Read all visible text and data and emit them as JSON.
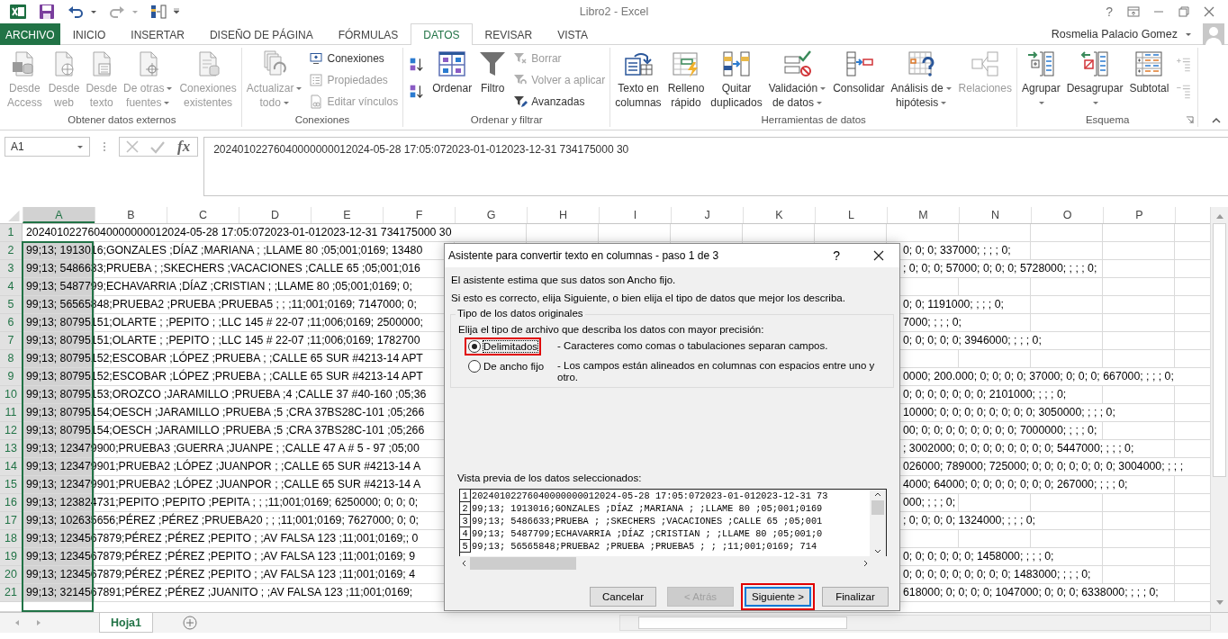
{
  "window": {
    "title": "Libro2 - Excel",
    "help": "?"
  },
  "tabs": [
    {
      "label": "ARCHIVO",
      "kind": "file",
      "selected": false
    },
    {
      "label": "INICIO",
      "kind": "tab",
      "selected": false
    },
    {
      "label": "INSERTAR",
      "kind": "tab",
      "selected": false
    },
    {
      "label": "DISEÑO DE PÁGINA",
      "kind": "tab",
      "selected": false
    },
    {
      "label": "FÓRMULAS",
      "kind": "tab",
      "selected": false
    },
    {
      "label": "DATOS",
      "kind": "tab",
      "selected": true
    },
    {
      "label": "REVISAR",
      "kind": "tab",
      "selected": false
    },
    {
      "label": "VISTA",
      "kind": "tab",
      "selected": false
    }
  ],
  "user": {
    "name": "Rosmelia Palacio Gomez"
  },
  "ribbon": {
    "groups": [
      {
        "label": "Obtener datos externos",
        "launcher": false,
        "items": [
          {
            "kind": "large",
            "lines": [
              "Desde",
              "Access"
            ],
            "disabled": true,
            "dropdown": false
          },
          {
            "kind": "large",
            "lines": [
              "Desde",
              "web"
            ],
            "disabled": true,
            "dropdown": false
          },
          {
            "kind": "large",
            "lines": [
              "Desde",
              "texto"
            ],
            "disabled": true,
            "dropdown": false
          },
          {
            "kind": "large",
            "lines": [
              "De otras",
              "fuentes"
            ],
            "disabled": true,
            "dropdown": true
          },
          {
            "kind": "large",
            "lines": [
              "Conexiones",
              "existentes"
            ],
            "disabled": true,
            "dropdown": false
          }
        ]
      },
      {
        "label": "Conexiones",
        "launcher": false,
        "items": [
          {
            "kind": "large",
            "lines": [
              "Actualizar",
              "todo"
            ],
            "disabled": true,
            "dropdown": true
          },
          {
            "kind": "small",
            "lines": [
              "Conexiones"
            ],
            "disabled": false
          },
          {
            "kind": "small",
            "lines": [
              "Propiedades"
            ],
            "disabled": true
          },
          {
            "kind": "small",
            "lines": [
              "Editar vínculos"
            ],
            "disabled": true
          }
        ]
      },
      {
        "label": "Ordenar y filtrar",
        "launcher": false,
        "items": [
          {
            "kind": "icon",
            "disabled": false
          },
          {
            "kind": "icon",
            "disabled": false
          },
          {
            "kind": "large",
            "lines": [
              "Ordenar"
            ],
            "disabled": false,
            "dropdown": false
          },
          {
            "kind": "large",
            "lines": [
              "Filtro"
            ],
            "disabled": false,
            "dropdown": false
          },
          {
            "kind": "small",
            "lines": [
              "Borrar"
            ],
            "disabled": true
          },
          {
            "kind": "small",
            "lines": [
              "Volver a aplicar"
            ],
            "disabled": true
          },
          {
            "kind": "small",
            "lines": [
              "Avanzadas"
            ],
            "disabled": false
          }
        ]
      },
      {
        "label": "Herramientas de datos",
        "launcher": false,
        "items": [
          {
            "kind": "large",
            "lines": [
              "Texto en",
              "columnas"
            ],
            "disabled": false,
            "dropdown": false
          },
          {
            "kind": "large",
            "lines": [
              "Relleno",
              "rápido"
            ],
            "disabled": false,
            "dropdown": false
          },
          {
            "kind": "large",
            "lines": [
              "Quitar",
              "duplicados"
            ],
            "disabled": false,
            "dropdown": false
          },
          {
            "kind": "large",
            "lines": [
              "Validación",
              "de datos"
            ],
            "disabled": false,
            "dropdown": true
          },
          {
            "kind": "large",
            "lines": [
              "Consolidar"
            ],
            "disabled": false,
            "dropdown": false
          },
          {
            "kind": "large",
            "lines": [
              "Análisis de",
              "hipótesis"
            ],
            "disabled": false,
            "dropdown": true
          },
          {
            "kind": "large",
            "lines": [
              "Relaciones"
            ],
            "disabled": true,
            "dropdown": false
          }
        ]
      },
      {
        "label": "Esquema",
        "launcher": true,
        "items": [
          {
            "kind": "large",
            "lines": [
              "Agrupar"
            ],
            "disabled": false,
            "dropdown": true
          },
          {
            "kind": "large",
            "lines": [
              "Desagrupar"
            ],
            "disabled": false,
            "dropdown": true
          },
          {
            "kind": "large",
            "lines": [
              "Subtotal"
            ],
            "disabled": false,
            "dropdown": false
          },
          {
            "kind": "icon",
            "disabled": true
          },
          {
            "kind": "icon",
            "disabled": true
          }
        ]
      }
    ]
  },
  "formula_bar": {
    "name_box": "A1",
    "fx": "fx",
    "value": "20240102276040000000012024-05-28 17:05:072023-01-012023-12-31 734175000 30"
  },
  "sheet": {
    "columns": [
      {
        "label": "A",
        "selected": true
      },
      {
        "label": "B",
        "selected": false
      },
      {
        "label": "C",
        "selected": false
      },
      {
        "label": "D",
        "selected": false
      },
      {
        "label": "E",
        "selected": false
      },
      {
        "label": "F",
        "selected": false
      },
      {
        "label": "G",
        "selected": false
      },
      {
        "label": "H",
        "selected": false
      },
      {
        "label": "I",
        "selected": false
      },
      {
        "label": "J",
        "selected": false
      },
      {
        "label": "K",
        "selected": false
      },
      {
        "label": "L",
        "selected": false
      },
      {
        "label": "M",
        "selected": false
      },
      {
        "label": "N",
        "selected": false
      },
      {
        "label": "O",
        "selected": false
      },
      {
        "label": "P",
        "selected": false
      }
    ],
    "rows": [
      {
        "number": "1",
        "left": "20240102276040000000012024-05-28 17:05:072023-01-012023-12-31 734175000 30"
      },
      {
        "number": "2",
        "left": "99;13; 1913016;GONZALES ;DÍAZ ;MARIANA ; ;LLAME 80 ;05;001;0169; 13480",
        "right": "0; 0; 0; 337000; ; ; ; 0;"
      },
      {
        "number": "3",
        "left": "99;13; 5486633;PRUEBA ; ;SKECHERS ;VACACIONES ;CALLE 65 ;05;001;016",
        "right": "; 0; 0; 0; 57000; 0; 0; 0; 5728000; ; ; ; 0;"
      },
      {
        "number": "4",
        "left": "99;13; 5487799;ECHAVARRIA ;DÍAZ ;CRISTIAN ; ;LLAME 80 ;05;001;0169; 0;"
      },
      {
        "number": "5",
        "left": "99;13; 56565848;PRUEBA2 ;PRUEBA ;PRUEBA5 ; ; ;11;001;0169; 7147000; 0;",
        "right": "0; 0; 1191000; ; ; ; 0;"
      },
      {
        "number": "6",
        "left": "99;13; 80795151;OLARTE ; ;PEPITO ; ;LLC 145 # 22-07 ;11;006;0169; 2500000;",
        "right": "7000; ; ; ; 0;"
      },
      {
        "number": "7",
        "left": "99;13; 80795151;OLARTE ; ;PEPITO ; ;LLC 145 # 22-07 ;11;006;0169; 1782700",
        "right": "0; 0; 0; 0; 0; 3946000; ; ; ; 0;"
      },
      {
        "number": "8",
        "left": "99;13; 80795152;ESCOBAR ;LÓPEZ ;PRUEBA ; ;CALLE 65 SUR #4213-14 APT"
      },
      {
        "number": "9",
        "left": "99;13; 80795152;ESCOBAR ;LÓPEZ ;PRUEBA ; ;CALLE 65 SUR #4213-14 APT",
        "right": "0000; 200.000; 0; 0; 0; 0; 37000; 0; 0; 0; 667000; ; ; ; 0;"
      },
      {
        "number": "10",
        "left": "99;13; 80795153;OROZCO ;JARAMILLO ;PRUEBA ;4 ;CALLE 37 #40-160 ;05;36",
        "right": "0; 0; 0; 0; 0; 0; 0; 2101000; ; ; ; 0;"
      },
      {
        "number": "11",
        "left": "99;13; 80795154;OESCH ;JARAMILLO ;PRUEBA ;5 ;CRA 37BS28C-101 ;05;266",
        "right": "10000; 0; 0; 0; 0; 0; 0; 0; 0; 3050000; ; ; ; 0;"
      },
      {
        "number": "12",
        "left": "99;13; 80795154;OESCH ;JARAMILLO ;PRUEBA ;5 ;CRA 37BS28C-101 ;05;266",
        "right": "00; 0; 0; 0; 0; 0; 0; 0; 0; 7000000; ; ; ; 0;"
      },
      {
        "number": "13",
        "left": "99;13; 123479900;PRUEBA3 ;GUERRA ;JUANPE ; ;CALLE 47 A # 5 - 97 ;05;00",
        "right": "; 3002000; 0; 0; 0; 0; 0; 0; 0; 0; 5447000; ; ; ; 0;"
      },
      {
        "number": "14",
        "left": "99;13; 123479901;PRUEBA2 ;LÓPEZ ;JUANPOR ; ;CALLE 65 SUR #4213-14 A",
        "right": "026000; 789000; 725000; 0; 0; 0; 0; 0; 0; 0; 3004000; ; ; ;"
      },
      {
        "number": "15",
        "left": "99;13; 123479901;PRUEBA2 ;LÓPEZ ;JUANPOR ; ;CALLE 65 SUR #4213-14 A",
        "right": "4000; 64000; 0; 0; 0; 0; 0; 0; 0; 267000; ; ; ; 0;"
      },
      {
        "number": "16",
        "left": "99;13; 123824731;PEPITO ;PEPITO ;PEPITA ; ; ;11;001;0169; 6250000; 0; 0; 0;",
        "right": "000; ; ; ; 0;"
      },
      {
        "number": "17",
        "left": "99;13; 102635656;PÉREZ ;PÉREZ ;PRUEBA20 ; ; ;11;001;0169; 7627000; 0; 0;",
        "right": "; 0; 0; 0; 0; 1324000; ; ; ; 0;"
      },
      {
        "number": "18",
        "left": "99;13; 1234567879;PÉREZ ;PÉREZ ;PEPITO ; ;AV FALSA 123 ;11;001;0169;; 0"
      },
      {
        "number": "19",
        "left": "99;13; 1234567879;PÉREZ ;PÉREZ ;PEPITO ; ;AV FALSA 123 ;11;001;0169; 9",
        "right": "0; 0; 0; 0; 0; 0; 1458000; ; ; ; 0;"
      },
      {
        "number": "20",
        "left": "99;13; 1234567879;PÉREZ ;PÉREZ ;PEPITO ; ;AV FALSA 123 ;11;001;0169; 4",
        "right": "0; 0; 0; 0; 0; 0; 0; 0; 0; 1483000; ; ; ; 0;"
      },
      {
        "number": "21",
        "left": "99;13; 3214567891;PÉREZ ;PÉREZ ;JUANITO ; ;AV FALSA 123 ;11;001;0169;",
        "right": "618000; 0; 0; 0; 0; 1047000; 0; 0; 0; 6338000; ; ; ; 0;"
      }
    ]
  },
  "sheet_tabs": [
    {
      "label": "Hoja1",
      "selected": true
    }
  ],
  "dialog": {
    "title": "Asistente para convertir texto en columnas - paso 1 de 3",
    "help": "?",
    "intro": [
      "El asistente estima que sus datos son Ancho fijo.",
      "Si esto es correcto, elija Siguiente, o bien elija el tipo de datos que mejor los describa."
    ],
    "group_title": "Tipo de los datos originales",
    "prompt": "Elija el tipo de archivo que describa los datos con mayor precisión:",
    "options": [
      {
        "label": "Delimitados",
        "description": "- Caracteres como comas o tabulaciones separan campos.",
        "selected": true,
        "annotated": true
      },
      {
        "label": "De ancho fijo",
        "description": "- Los campos están alineados en columnas con espacios entre uno y otro.",
        "selected": false,
        "annotated": false
      }
    ],
    "preview_label": "Vista previa de los datos seleccionados:",
    "preview": [
      {
        "number": "1",
        "text": "20240102276040000000012024-05-28 17:05:072023-01-012023-12-31 73"
      },
      {
        "number": "2",
        "text": "99;13; 1913016;GONZALES ;DÍAZ ;MARIANA ; ;LLAME 80 ;05;001;0169"
      },
      {
        "number": "3",
        "text": "99;13; 5486633;PRUEBA ; ;SKECHERS ;VACACIONES ;CALLE 65 ;05;001"
      },
      {
        "number": "4",
        "text": "99;13; 5487799;ECHAVARRIA ;DÍAZ ;CRISTIAN ; ;LLAME 80 ;05;001;0"
      },
      {
        "number": "5",
        "text": "99;13; 56565848;PRUEBA2 ;PRUEBA ;PRUEBA5 ; ; ;11;001;0169; 714"
      }
    ],
    "buttons": [
      {
        "label": "Cancelar",
        "disabled": false,
        "default": false,
        "annotated": false
      },
      {
        "label": "< Atrás",
        "disabled": true,
        "default": false,
        "annotated": false
      },
      {
        "label": "Siguiente >",
        "disabled": false,
        "default": true,
        "annotated": true
      },
      {
        "label": "Finalizar",
        "disabled": false,
        "default": false,
        "annotated": false
      }
    ]
  }
}
